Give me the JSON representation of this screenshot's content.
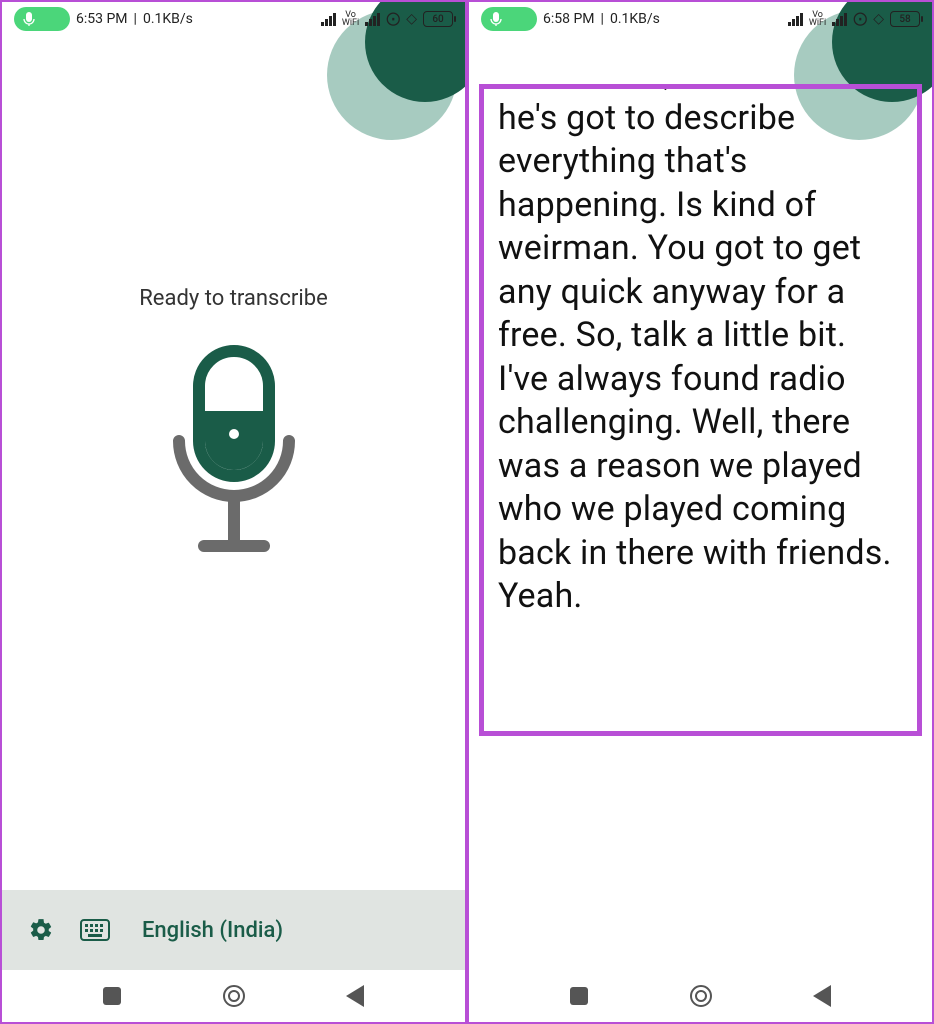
{
  "left": {
    "status": {
      "time": "6:53 PM",
      "speed": "0.1KB/s",
      "battery": "60"
    },
    "readyText": "Ready to transcribe",
    "bottomBar": {
      "language": "English (India)"
    }
  },
  "right": {
    "status": {
      "time": "6:58 PM",
      "speed": "0.1KB/s",
      "battery": "58"
    },
    "transcript": "have Court, because then he's got to describe everything that's happening. Is kind of weirman. You got to get any quick anyway for a free. So, talk a little bit. I've always found radio challenging. Well, there was a reason we played who we played coming back in there with friends. Yeah."
  }
}
